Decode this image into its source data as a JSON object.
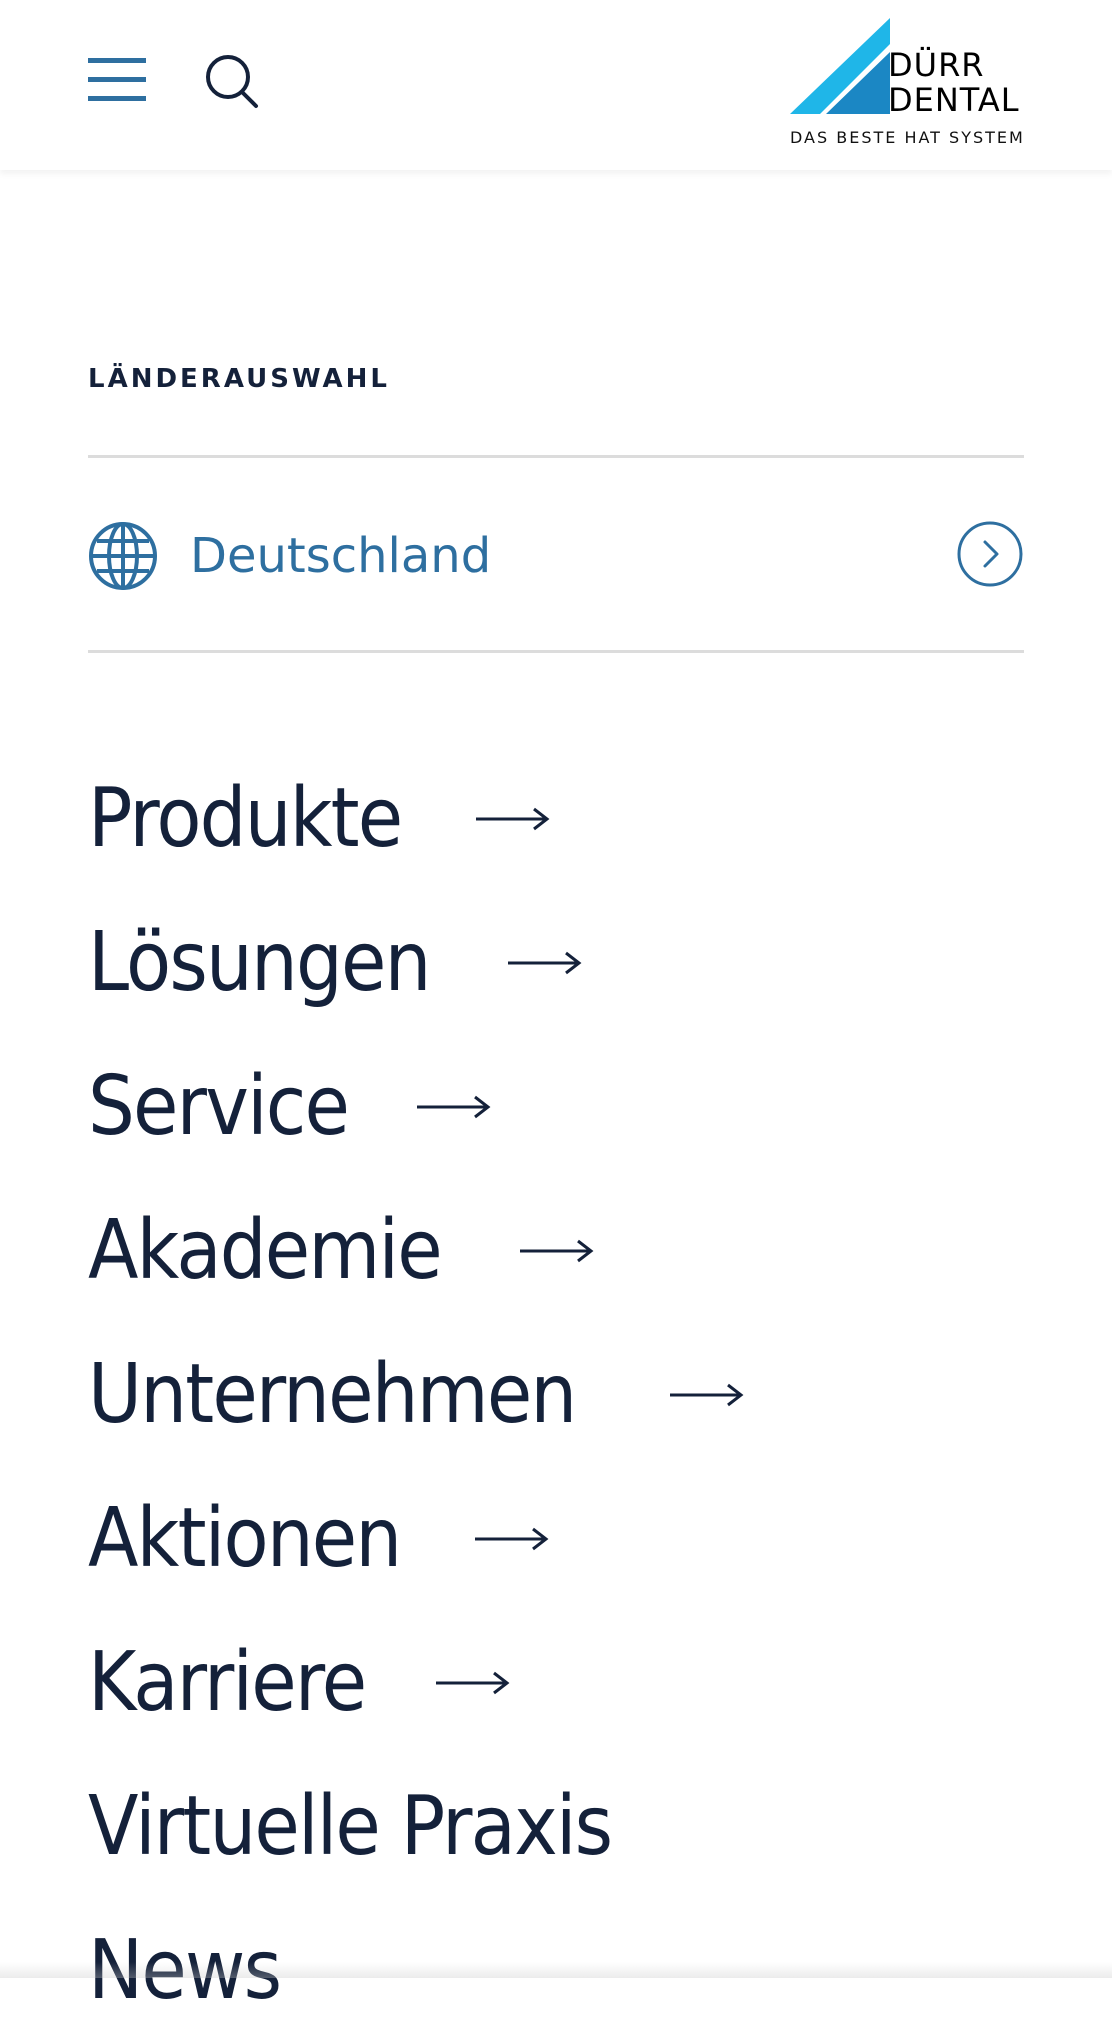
{
  "header": {
    "menu_icon": "hamburger-menu-icon",
    "search_icon": "search-icon",
    "logo": {
      "word1": "DÜRR",
      "word2": "DENTAL",
      "tagline": "DAS BESTE HAT SYSTEM"
    }
  },
  "country": {
    "section_label": "LÄNDERAUSWAHL",
    "selected": "Deutschland",
    "icon": "globe-icon",
    "arrow_icon": "chevron-right-circle-icon"
  },
  "nav": {
    "items": [
      {
        "label": "Produkte",
        "has_arrow": true
      },
      {
        "label": "Lösungen",
        "has_arrow": true
      },
      {
        "label": "Service",
        "has_arrow": true
      },
      {
        "label": "Akademie",
        "has_arrow": true
      },
      {
        "label": "Unternehmen",
        "has_arrow": true
      },
      {
        "label": "Aktionen",
        "has_arrow": true
      },
      {
        "label": "Karriere",
        "has_arrow": true
      },
      {
        "label": "Virtuelle Praxis",
        "has_arrow": false
      },
      {
        "label": "News",
        "has_arrow": false
      }
    ]
  },
  "colors": {
    "text_dark": "#14213a",
    "accent_blue": "#2e6fa0",
    "logo_cyan": "#1fb6e8",
    "logo_blue": "#1b87c4",
    "divider": "#dcdcdc"
  }
}
